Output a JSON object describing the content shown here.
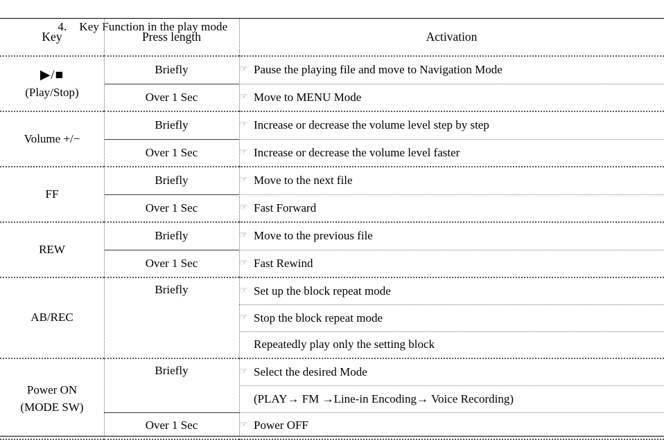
{
  "heading": {
    "number": "4.",
    "text": "Key Function in the play mode"
  },
  "table": {
    "columns": [
      "Key",
      "Press length",
      "Activation"
    ],
    "hand_icon": "☞",
    "rows": [
      {
        "key_lines": [
          "▶/■",
          "(Play/Stop)"
        ],
        "key_is_glyph": true,
        "entries": [
          {
            "press": "Briefly",
            "activations": [
              {
                "icon": true,
                "text": "Pause the playing file and move to Navigation Mode"
              }
            ]
          },
          {
            "press": "Over 1 Sec",
            "activations": [
              {
                "icon": true,
                "text": "Move to MENU Mode"
              }
            ]
          }
        ]
      },
      {
        "key_lines": [
          "Volume +/−"
        ],
        "key_is_glyph": false,
        "entries": [
          {
            "press": "Briefly",
            "activations": [
              {
                "icon": true,
                "text": "Increase or decrease the volume level step by step"
              }
            ]
          },
          {
            "press": "Over 1 Sec",
            "activations": [
              {
                "icon": true,
                "text": "Increase or decrease the volume level faster"
              }
            ]
          }
        ]
      },
      {
        "key_lines": [
          "FF"
        ],
        "key_is_glyph": false,
        "entries": [
          {
            "press": "Briefly",
            "activations": [
              {
                "icon": true,
                "text": "Move to the next file"
              }
            ]
          },
          {
            "press": "Over 1 Sec",
            "activations": [
              {
                "icon": true,
                "text": "Fast Forward"
              }
            ]
          }
        ]
      },
      {
        "key_lines": [
          "REW"
        ],
        "key_is_glyph": false,
        "entries": [
          {
            "press": "Briefly",
            "activations": [
              {
                "icon": true,
                "text": "Move to the previous file"
              }
            ]
          },
          {
            "press": "Over 1 Sec",
            "activations": [
              {
                "icon": true,
                "text": "Fast Rewind"
              }
            ]
          }
        ]
      },
      {
        "key_lines": [
          "AB/REC"
        ],
        "key_is_glyph": false,
        "entries": [
          {
            "press": "Briefly",
            "activations": [
              {
                "icon": true,
                "text": "Set up the block repeat mode"
              },
              {
                "icon": true,
                "text": "Stop the block repeat mode"
              },
              {
                "icon": false,
                "text": "Repeatedly play only the setting block"
              }
            ]
          }
        ]
      },
      {
        "key_lines": [
          "Power ON",
          "(MODE SW)"
        ],
        "key_is_glyph": false,
        "entries": [
          {
            "press": "Briefly",
            "activations": [
              {
                "icon": true,
                "text": "Select the desired Mode"
              },
              {
                "icon": false,
                "text": "(PLAY→ FM →Line-in Encoding→ Voice Recording)"
              }
            ]
          },
          {
            "press": "Over 1 Sec",
            "activations": [
              {
                "icon": true,
                "text": "Power OFF"
              }
            ]
          }
        ]
      }
    ]
  }
}
